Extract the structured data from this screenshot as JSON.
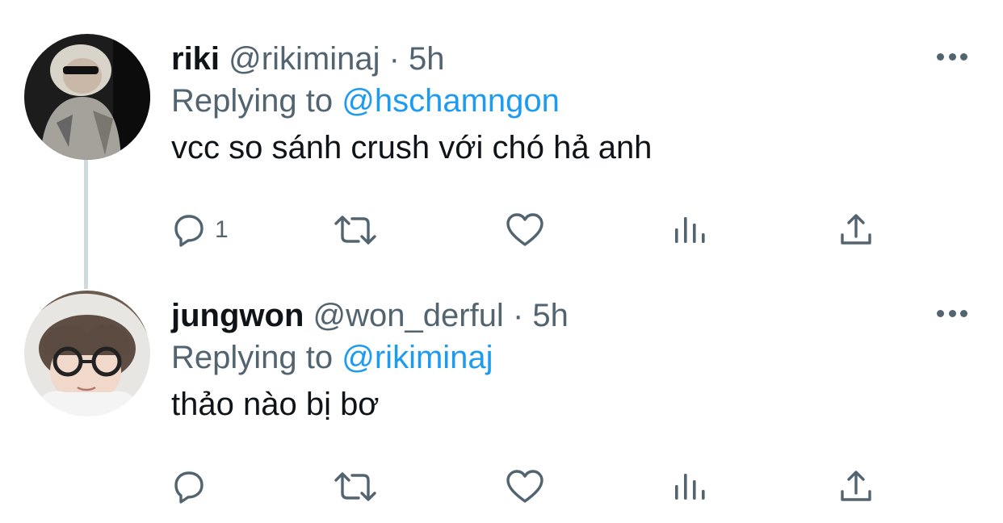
{
  "tweets": [
    {
      "display_name": "riki",
      "handle": "@rikiminaj",
      "separator": "·",
      "time": "5h",
      "replying_prefix": "Replying to",
      "replying_to": "@hschamngon",
      "text": "vcc so sánh crush với chó hả anh",
      "reply_count": "1",
      "avatar_icon": "profile-photo"
    },
    {
      "display_name": "jungwon",
      "handle": "@won_derful",
      "separator": "·",
      "time": "5h",
      "replying_prefix": "Replying to",
      "replying_to": "@rikiminaj",
      "text": "thảo nào bị bơ",
      "reply_count": "",
      "avatar_icon": "profile-photo"
    }
  ],
  "icons": [
    "reply-icon",
    "retweet-icon",
    "like-icon",
    "analytics-icon",
    "share-icon",
    "more-icon"
  ],
  "colors": {
    "text": "#0f1419",
    "secondary": "#536471",
    "link": "#1d9bf0",
    "thread_line": "#cfd9de"
  }
}
